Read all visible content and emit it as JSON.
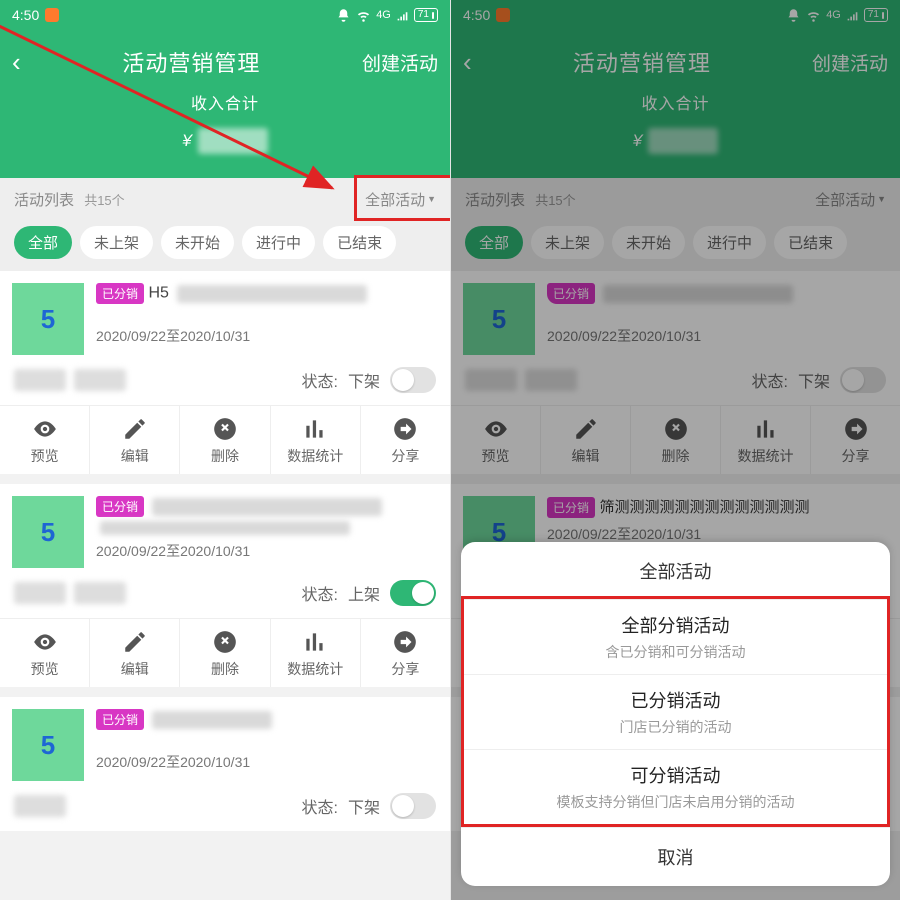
{
  "status": {
    "time": "4:50",
    "net": "4G",
    "battery": "71"
  },
  "header": {
    "title": "活动营销管理",
    "create": "创建活动",
    "summary_label": "收入合计",
    "currency": "¥"
  },
  "filter": {
    "list_label": "活动列表",
    "count": "共15个",
    "dropdown": "全部活动",
    "tabs": [
      "全部",
      "未上架",
      "未开始",
      "进行中",
      "已结束"
    ]
  },
  "card1": {
    "thumb": "5",
    "tag": "已分销",
    "name_prefix": "H5",
    "date": "2020/09/22至2020/10/31",
    "state_label": "状态:",
    "state_value": "下架"
  },
  "card2": {
    "thumb": "5",
    "tag": "已分销",
    "date": "2020/09/22至2020/10/31",
    "state_label": "状态:",
    "state_value": "上架"
  },
  "card3": {
    "thumb": "5",
    "tag": "已分销",
    "date": "2020/09/22至2020/10/31",
    "state_label": "状态:",
    "state_value": "下架"
  },
  "actions": {
    "preview": "预览",
    "edit": "编辑",
    "delete": "删除",
    "stats": "数据统计",
    "share": "分享"
  },
  "sheet": {
    "title": "全部活动",
    "opt1_t": "全部分销活动",
    "opt1_d": "含已分销和可分销活动",
    "opt2_t": "已分销活动",
    "opt2_d": "门店已分销的活动",
    "opt3_t": "可分销活动",
    "opt3_d": "模板支持分销但门店未启用分销的活动",
    "cancel": "取消"
  }
}
